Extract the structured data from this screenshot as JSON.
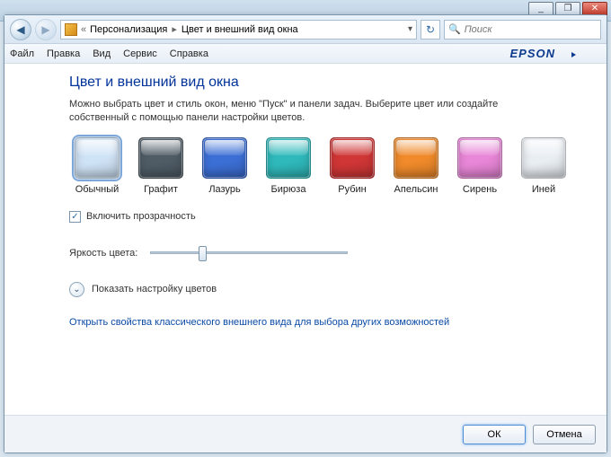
{
  "win": {
    "min": "_",
    "max": "❐",
    "close": "✕"
  },
  "nav": {
    "crumb_lead": "«",
    "crumb1": "Персонализация",
    "crumb2": "Цвет и внешний вид окна",
    "dropdown_glyph": "▾"
  },
  "refresh_glyph": "↻",
  "search": {
    "placeholder": "Поиск",
    "icon": "🔍"
  },
  "menu": {
    "items": [
      "Файл",
      "Правка",
      "Вид",
      "Сервис",
      "Справка"
    ],
    "brand": "EPSON"
  },
  "page": {
    "title": "Цвет и внешний вид окна",
    "desc": "Можно выбрать цвет и стиль окон, меню \"Пуск\" и панели задач. Выберите цвет или создайте собственный с помощью панели настройки цветов."
  },
  "swatches": [
    {
      "label": "Обычный",
      "color": "#cfe3f6",
      "selected": true
    },
    {
      "label": "Графит",
      "color": "#4f5c66",
      "selected": false
    },
    {
      "label": "Лазурь",
      "color": "#3c6fd6",
      "selected": false
    },
    {
      "label": "Бирюза",
      "color": "#2fb9bb",
      "selected": false
    },
    {
      "label": "Рубин",
      "color": "#d13636",
      "selected": false
    },
    {
      "label": "Апельсин",
      "color": "#f08a2a",
      "selected": false
    },
    {
      "label": "Сирень",
      "color": "#e886d7",
      "selected": false
    },
    {
      "label": "Иней",
      "color": "#e9eef3",
      "selected": false
    }
  ],
  "transparency": {
    "checked": true,
    "label": "Включить прозрачность",
    "mark": "✓"
  },
  "slider": {
    "label": "Яркость цвета:",
    "position_pct": 24
  },
  "expand": {
    "glyph": "⌄",
    "label": "Показать настройку цветов"
  },
  "classic_link": "Открыть свойства классического внешнего вида для выбора других возможностей",
  "buttons": {
    "ok": "ОК",
    "cancel": "Отмена"
  }
}
